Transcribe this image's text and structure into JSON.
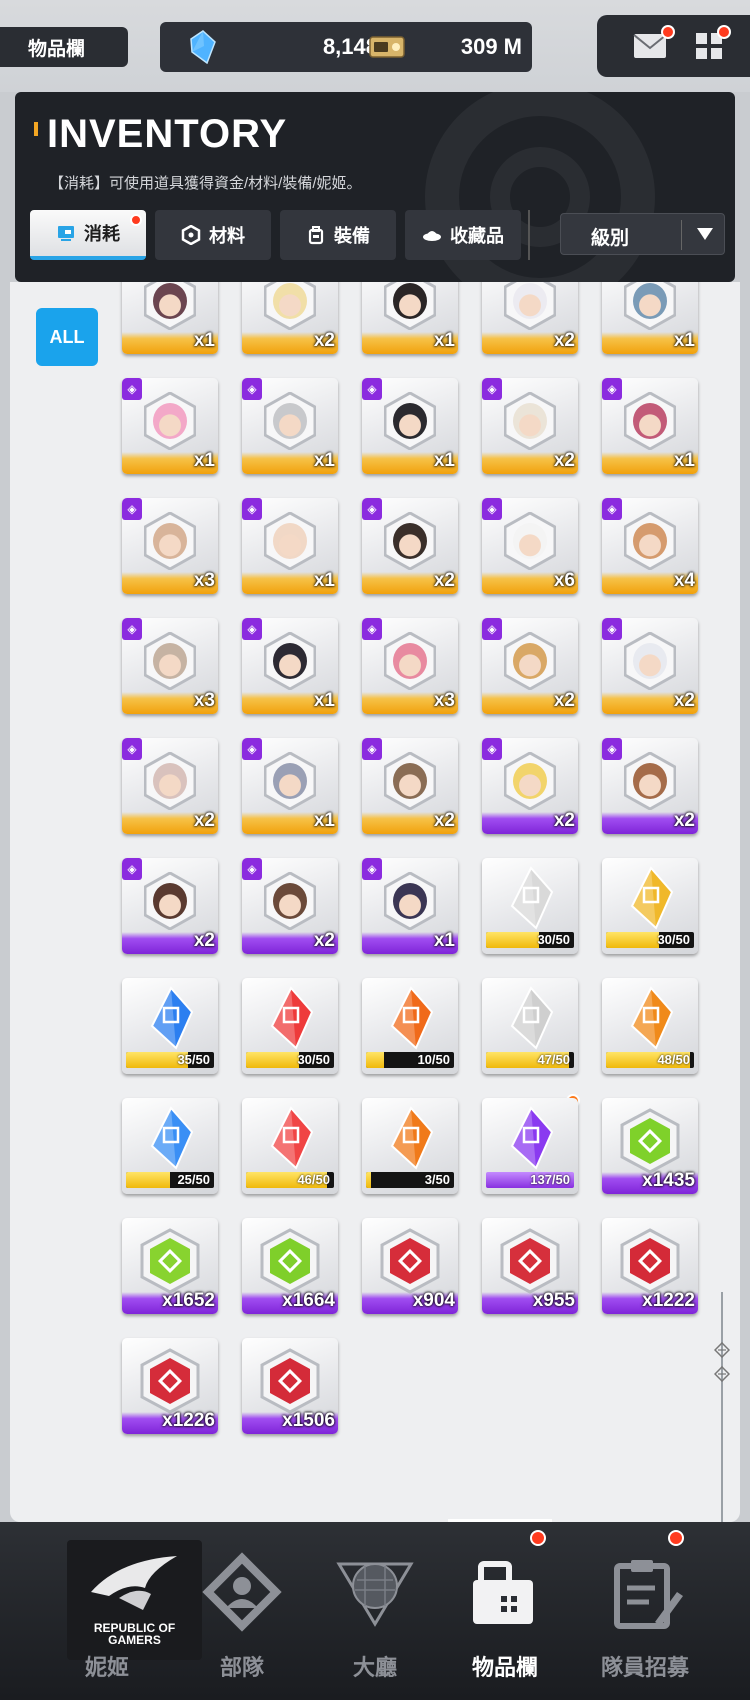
{
  "top_bar": {
    "page_tag": "物品欄",
    "gems": "8,148",
    "gem_plus": "+",
    "credits": "309 M"
  },
  "header": {
    "title": "INVENTORY",
    "description": "【消耗】可使用道具獲得資金/材料/裝備/妮姬。",
    "tabs": [
      {
        "label": "消耗",
        "active": true
      },
      {
        "label": "材料",
        "active": false
      },
      {
        "label": "裝備",
        "active": false
      },
      {
        "label": "收藏品",
        "active": false
      }
    ],
    "sort_label": "級別"
  },
  "filter": {
    "all_label": "ALL"
  },
  "colors": {
    "accent_blue": "#1aa3ec",
    "rarity_gold": "#f1a10c",
    "rarity_purple": "#8b2bdf",
    "notification_red": "#ff3b1f"
  },
  "items": [
    {
      "kind": "char",
      "rarity": "gold",
      "badge": "p",
      "count": "x1",
      "hair": "#6b4550"
    },
    {
      "kind": "char",
      "rarity": "gold",
      "badge": "p",
      "count": "x2",
      "hair": "#f1dfa8"
    },
    {
      "kind": "char",
      "rarity": "gold",
      "badge": "p",
      "count": "x1",
      "hair": "#2a2526"
    },
    {
      "kind": "char",
      "rarity": "gold",
      "badge": "p",
      "count": "x2",
      "hair": "#ecebf1"
    },
    {
      "kind": "char",
      "rarity": "gold",
      "badge": "p",
      "count": "x1",
      "hair": "#7a9bb7"
    },
    {
      "kind": "char",
      "rarity": "gold",
      "badge": "p",
      "count": "x1",
      "hair": "#f3a8c8"
    },
    {
      "kind": "char",
      "rarity": "gold",
      "badge": "p",
      "count": "x1",
      "hair": "#c8c9cc"
    },
    {
      "kind": "char",
      "rarity": "gold",
      "badge": "p",
      "count": "x1",
      "hair": "#2b2a2f"
    },
    {
      "kind": "char",
      "rarity": "gold",
      "badge": "p",
      "count": "x2",
      "hair": "#ebe4d8"
    },
    {
      "kind": "char",
      "rarity": "gold",
      "badge": "p",
      "count": "x1",
      "hair": "#c25b78"
    },
    {
      "kind": "char",
      "rarity": "gold",
      "badge": "p",
      "count": "x3",
      "hair": "#d8b49a"
    },
    {
      "kind": "char",
      "rarity": "gold",
      "badge": "p",
      "count": "x1",
      "hair": "#f1d8c6"
    },
    {
      "kind": "char",
      "rarity": "gold",
      "badge": "p",
      "count": "x2",
      "hair": "#3a2f2a"
    },
    {
      "kind": "char",
      "rarity": "gold",
      "badge": "p",
      "count": "x6",
      "hair": "#f4f4f4"
    },
    {
      "kind": "char",
      "rarity": "gold",
      "badge": "p",
      "count": "x4",
      "hair": "#d59b6e"
    },
    {
      "kind": "char",
      "rarity": "gold",
      "badge": "p",
      "count": "x3",
      "hair": "#c6b3a3"
    },
    {
      "kind": "char",
      "rarity": "gold",
      "badge": "p",
      "count": "x1",
      "hair": "#2d2a33"
    },
    {
      "kind": "char",
      "rarity": "gold",
      "badge": "p",
      "count": "x3",
      "hair": "#e88aa0"
    },
    {
      "kind": "char",
      "rarity": "gold",
      "badge": "p",
      "count": "x2",
      "hair": "#d9a866"
    },
    {
      "kind": "char",
      "rarity": "gold",
      "badge": "p",
      "count": "x2",
      "hair": "#e8eaf0"
    },
    {
      "kind": "char",
      "rarity": "gold",
      "badge": "p",
      "count": "x2",
      "hair": "#d9c2bd"
    },
    {
      "kind": "char",
      "rarity": "gold",
      "badge": "p",
      "count": "x1",
      "hair": "#9aa0b5"
    },
    {
      "kind": "char",
      "rarity": "gold",
      "badge": "p",
      "count": "x2",
      "hair": "#8a6d55"
    },
    {
      "kind": "char",
      "rarity": "purple",
      "badge": "p",
      "count": "x2",
      "hair": "#f2d46b"
    },
    {
      "kind": "char",
      "rarity": "purple",
      "badge": "p",
      "count": "x2",
      "hair": "#a56c4a"
    },
    {
      "kind": "char",
      "rarity": "purple",
      "badge": "p",
      "count": "x2",
      "hair": "#5a3a30"
    },
    {
      "kind": "char",
      "rarity": "purple",
      "badge": "p",
      "count": "x2",
      "hair": "#6b4a3a"
    },
    {
      "kind": "char",
      "rarity": "purple",
      "badge": "p",
      "count": "x1",
      "hair": "#3b3654"
    },
    {
      "kind": "shard",
      "color": "#d9d9d9",
      "label": "30/50",
      "progress": 0.6,
      "bar": "gold"
    },
    {
      "kind": "shard",
      "color": "#f0b82a",
      "label": "30/50",
      "progress": 0.6,
      "bar": "gold"
    },
    {
      "kind": "shard",
      "color": "#2c7ff0",
      "label": "35/50",
      "progress": 0.7,
      "bar": "gold"
    },
    {
      "kind": "shard",
      "color": "#ee3b3b",
      "label": "30/50",
      "progress": 0.6,
      "bar": "gold"
    },
    {
      "kind": "shard",
      "color": "#f06a1a",
      "label": "10/50",
      "progress": 0.2,
      "bar": "gold"
    },
    {
      "kind": "shard",
      "color": "#cfcfcf",
      "label": "47/50",
      "progress": 0.94,
      "bar": "gold"
    },
    {
      "kind": "shard",
      "color": "#f08a1a",
      "label": "48/50",
      "progress": 0.96,
      "bar": "gold"
    },
    {
      "kind": "shard",
      "color": "#3a8ff5",
      "label": "25/50",
      "progress": 0.5,
      "bar": "gold"
    },
    {
      "kind": "shard",
      "color": "#f04545",
      "label": "46/50",
      "progress": 0.92,
      "bar": "gold"
    },
    {
      "kind": "shard",
      "color": "#f07a1a",
      "label": "3/50",
      "progress": 0.06,
      "bar": "gold"
    },
    {
      "kind": "shard",
      "color": "#8a3af0",
      "label": "137/50",
      "progress": 1.0,
      "bar": "purple",
      "dot": true
    },
    {
      "kind": "material",
      "color": "#7fd12a",
      "count": "x1435"
    },
    {
      "kind": "material",
      "color": "#88d32f",
      "count": "x1652"
    },
    {
      "kind": "material",
      "color": "#7fcf2a",
      "count": "x1664"
    },
    {
      "kind": "material",
      "color": "#d62d3a",
      "count": "x904"
    },
    {
      "kind": "material",
      "color": "#d6303c",
      "count": "x955"
    },
    {
      "kind": "material",
      "color": "#d42a38",
      "count": "x1222"
    },
    {
      "kind": "material",
      "color": "#d52c3a",
      "count": "x1226"
    },
    {
      "kind": "material",
      "color": "#d42b39",
      "count": "x1506"
    }
  ],
  "bottom_nav": [
    {
      "label": "妮姬",
      "icon": "rog-logo-icon",
      "active": false
    },
    {
      "label": "部隊",
      "icon": "squad-icon",
      "active": false
    },
    {
      "label": "大廳",
      "icon": "lobby-icon",
      "active": false
    },
    {
      "label": "物品欄",
      "icon": "inventory-icon",
      "active": true
    },
    {
      "label": "隊員招募",
      "icon": "recruit-icon",
      "active": false
    }
  ],
  "rog_badge_text": "REPUBLIC OF GAMERS"
}
